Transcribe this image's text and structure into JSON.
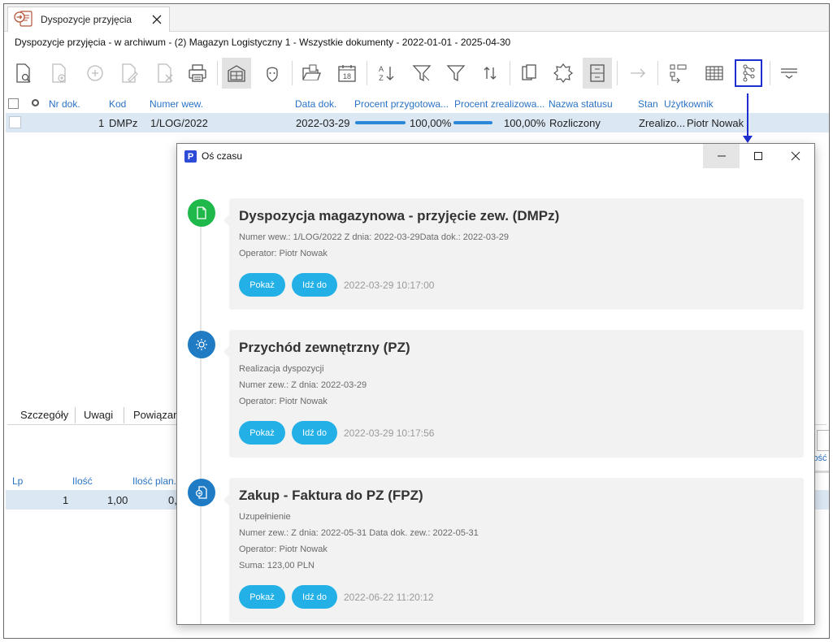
{
  "window": {
    "tab_label": "Dyspozycje przyjęcia",
    "breadcrumb": "Dyspozycje przyjęcia - w archiwum - (2) Magazyn Logistyczny 1 - Wszystkie dokumenty - 2022-01-01 - 2025-04-30"
  },
  "toolbar": {
    "icons": [
      "preview-icon",
      "add-document-icon",
      "add-icon",
      "edit-icon",
      "delete-icon",
      "print-icon",
      "archive-icon",
      "operator-icon",
      "open-folder-icon",
      "calendar-icon",
      "sort-icon",
      "filter-icon",
      "filter-clear-icon",
      "refresh-icon",
      "copy-icon",
      "badge-icon",
      "cabinet-icon",
      "arrow-right-icon",
      "structure-icon",
      "table-icon",
      "timeline-icon",
      "menu-icon"
    ],
    "calendar_day": "18",
    "sort_glyph_top": "A",
    "sort_glyph_bottom": "Z"
  },
  "grid": {
    "columns": [
      "Nr dok.",
      "Kod",
      "Numer wew.",
      "Data dok.",
      "Procent przygotowa...",
      "Procent zrealizowa...",
      "Nazwa statusu",
      "Stan",
      "Użytkownik"
    ],
    "rows": [
      {
        "nr": "1",
        "kod": "DMPz",
        "numer_wew": "1/LOG/2022",
        "data": "2022-03-29",
        "procent_przygotowania": "100,00%",
        "procent_przygotowania_value": 1.0,
        "procent_zrealizowania": "100,00%",
        "procent_zrealizowania_value": 1.0,
        "status": "Rozliczony",
        "stan": "Zrealizo...",
        "uzytkownik": "Piotr Nowak"
      }
    ]
  },
  "lower_panel": {
    "tabs": [
      "Szczegóły",
      "Uwagi",
      "Powiązani"
    ],
    "columns": [
      "Lp",
      "Ilość",
      "Ilość plan."
    ],
    "rows": [
      {
        "lp": "1",
        "ilosc": "1,00",
        "ilosc_plan": "0,"
      }
    ],
    "right_header": "lość z"
  },
  "dialog": {
    "title": "Oś czasu",
    "logo_letter": "P",
    "events": [
      {
        "title": "Dyspozycja magazynowa - przyjęcie zew. (DMPz)",
        "lines": [
          "Numer wew.: 1/LOG/2022 Z dnia: 2022-03-29Data dok.: 2022-03-29",
          "Operator: Piotr Nowak"
        ],
        "show_label": "Pokaż",
        "goto_label": "Idź do",
        "timestamp": "2022-03-29 10:17:00",
        "icon": "document-icon",
        "color": "#1fb84a"
      },
      {
        "title": "Przychód zewnętrzny (PZ)",
        "lines": [
          "Realizacja dyspozycji",
          "Numer zew.: Z dnia: 2022-03-29",
          "Operator: Piotr Nowak"
        ],
        "show_label": "Pokaż",
        "goto_label": "Idź do",
        "timestamp": "2022-03-29 10:17:56",
        "icon": "gear-icon",
        "color": "#1e7bc4"
      },
      {
        "title": "Zakup - Faktura do PZ (FPZ)",
        "lines": [
          "Uzupełnienie",
          "Numer zew.: Z dnia: 2022-05-31 Data dok. zew.: 2022-05-31",
          "Operator: Piotr Nowak",
          "Suma: 123,00 PLN"
        ],
        "show_label": "Pokaż",
        "goto_label": "Idź do",
        "timestamp": "2022-06-22 11:20:12",
        "icon": "invoice-icon",
        "color": "#1e7bc4"
      }
    ]
  },
  "colors": {
    "accent_blue": "#2a73c5",
    "selection": "#dbe7f3",
    "pill": "#22b0e6",
    "highlight_frame": "#1d2fcf"
  }
}
